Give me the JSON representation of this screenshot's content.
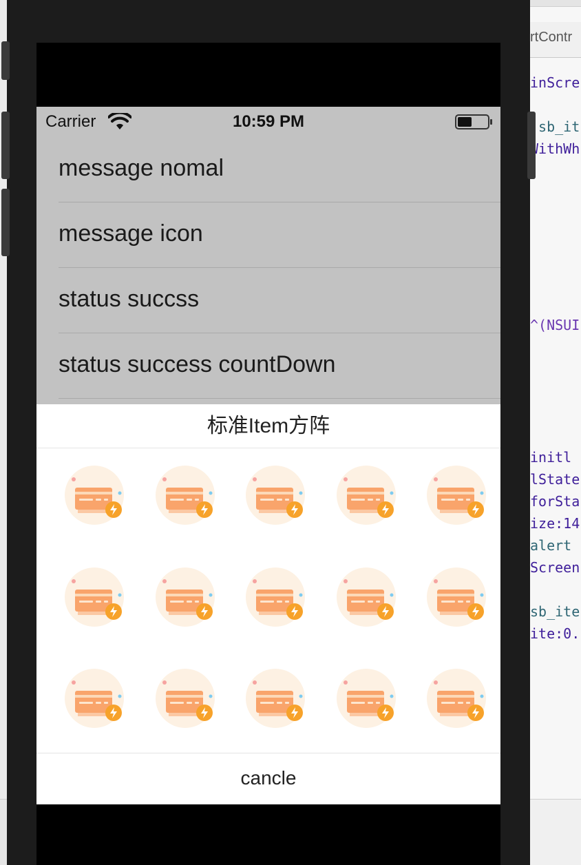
{
  "xcode": {
    "tab_title": "rtContr",
    "code_lines": [
      {
        "text": "inScre"
      },
      {
        "text": ".sb_it"
      },
      {
        "text": "WithWh"
      },
      {
        "text": "^(NSUI"
      },
      {
        "text": " initl"
      },
      {
        "text": "lState"
      },
      {
        "text": "forSta"
      },
      {
        "text": "ize:14"
      },
      {
        "text": " alert"
      },
      {
        "text": "Screen"
      },
      {
        "text": "sb_ite"
      },
      {
        "text": "ite:0."
      }
    ]
  },
  "status_bar": {
    "carrier": "Carrier",
    "time": "10:59 PM",
    "wifi_icon": "wifi-icon",
    "battery_icon": "battery-icon"
  },
  "list": {
    "items": [
      {
        "label": "message nomal"
      },
      {
        "label": "message icon"
      },
      {
        "label": "status succss"
      },
      {
        "label": "status success countDown"
      }
    ]
  },
  "sheet": {
    "title": "标准Item方阵",
    "item_icon": "card-payment-icon",
    "rows": 3,
    "columns": 5,
    "cancel_label": "cancle"
  },
  "colors": {
    "overlay": "#c2c2c2",
    "icon_bg": "#fdf1e3",
    "icon_card": "#f9a46b",
    "icon_badge": "#f7a22a"
  }
}
